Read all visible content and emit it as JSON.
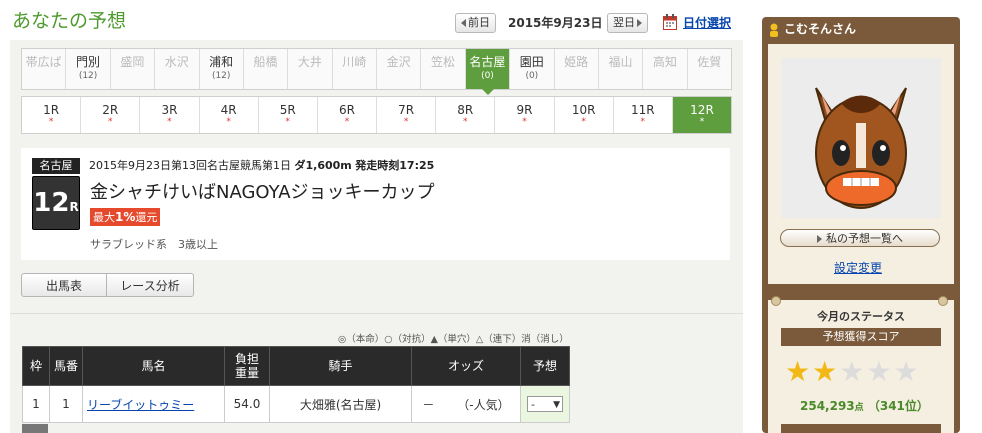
{
  "header": {
    "title": "あなたの予想",
    "prev_label": "前日",
    "date": "2015年9月23日",
    "next_label": "翌日",
    "calendar_label": "日付選択"
  },
  "venues": [
    {
      "name": "帯広ば",
      "count": ""
    },
    {
      "name": "門別",
      "count": "(12)"
    },
    {
      "name": "盛岡",
      "count": ""
    },
    {
      "name": "水沢",
      "count": ""
    },
    {
      "name": "浦和",
      "count": "(12)"
    },
    {
      "name": "船橋",
      "count": ""
    },
    {
      "name": "大井",
      "count": ""
    },
    {
      "name": "川崎",
      "count": ""
    },
    {
      "name": "金沢",
      "count": ""
    },
    {
      "name": "笠松",
      "count": ""
    },
    {
      "name": "名古屋",
      "count": "(0)"
    },
    {
      "name": "園田",
      "count": "(0)"
    },
    {
      "name": "姫路",
      "count": ""
    },
    {
      "name": "福山",
      "count": ""
    },
    {
      "name": "高知",
      "count": ""
    },
    {
      "name": "佐賀",
      "count": ""
    }
  ],
  "races": [
    {
      "label": "1R",
      "mark": "*"
    },
    {
      "label": "2R",
      "mark": "*"
    },
    {
      "label": "3R",
      "mark": "*"
    },
    {
      "label": "4R",
      "mark": "*"
    },
    {
      "label": "5R",
      "mark": "*"
    },
    {
      "label": "6R",
      "mark": "*"
    },
    {
      "label": "7R",
      "mark": "*"
    },
    {
      "label": "8R",
      "mark": "*"
    },
    {
      "label": "9R",
      "mark": "*"
    },
    {
      "label": "10R",
      "mark": "*"
    },
    {
      "label": "11R",
      "mark": "*"
    },
    {
      "label": "12R",
      "mark": "*"
    }
  ],
  "race_info": {
    "venue_badge": "名古屋",
    "race_number": "12",
    "race_suffix": "R",
    "meta": "2015年9月23日第13回名古屋競馬第1日",
    "course": "ダ1,600m",
    "start_time": "発走時刻17:25",
    "name": "金シャチけいばNAGOYAジョッキーカップ",
    "rebate_prefix": "最大",
    "rebate_value": "1%",
    "rebate_suffix": "還元",
    "conditions": "サラブレッド系　3歳以上"
  },
  "tabs": {
    "entries": "出馬表",
    "analysis": "レース分析"
  },
  "legend": "◎（本命）○（対抗）▲（単穴）△（連下）消（消し）",
  "table": {
    "headers": {
      "waku": "枠",
      "umaban": "馬番",
      "name": "馬名",
      "weight_1": "負担",
      "weight_2": "重量",
      "jockey": "騎手",
      "odds": "オッズ",
      "pred": "予想"
    },
    "rows": [
      {
        "waku": "1",
        "umaban": "1",
        "name": "リーブイットゥミー",
        "weight": "54.0",
        "jockey": "大畑雅(名古屋)",
        "odds": "－",
        "popularity": "（-人気）",
        "pred": "-"
      }
    ]
  },
  "sidebar": {
    "user": "こむそんさん",
    "my_predictions": "私の予想一覧へ",
    "settings": "設定変更",
    "status_title": "今月のステータス",
    "score_title": "予想獲得スコア",
    "rating": 2,
    "rating_max": 5,
    "score_value": "254,293",
    "score_unit": "点",
    "rank": "（341位）"
  }
}
